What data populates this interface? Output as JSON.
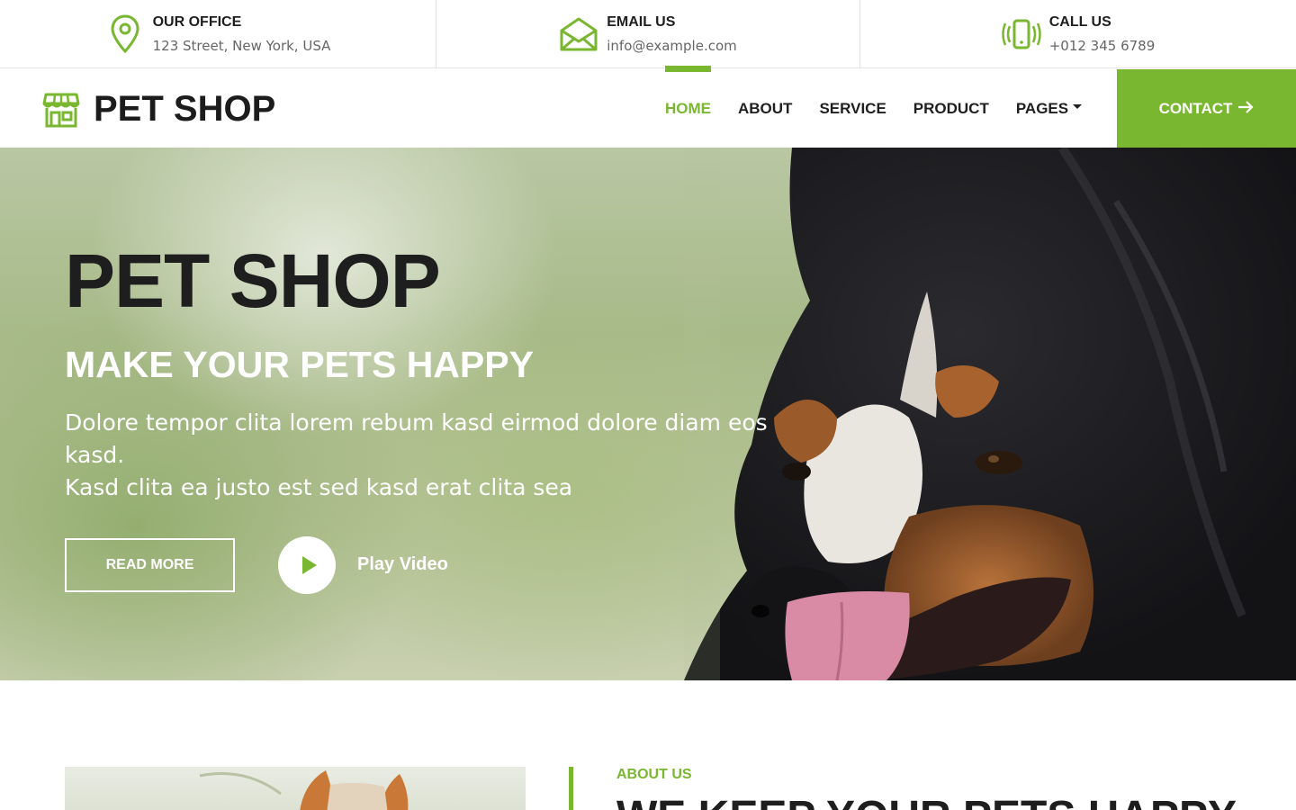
{
  "topbar": {
    "office": {
      "title": "OUR OFFICE",
      "text": "123 Street, New York, USA",
      "icon": "map-pin-icon"
    },
    "email": {
      "title": "EMAIL US",
      "text": "info@example.com",
      "icon": "envelope-icon"
    },
    "call": {
      "title": "CALL US",
      "text": "+012 345 6789",
      "icon": "vibrating-phone-icon"
    }
  },
  "brand": {
    "name": "PET SHOP",
    "icon": "storefront-icon"
  },
  "nav": {
    "items": [
      {
        "label": "HOME",
        "active": true
      },
      {
        "label": "ABOUT"
      },
      {
        "label": "SERVICE"
      },
      {
        "label": "PRODUCT"
      },
      {
        "label": "PAGES",
        "dropdown": true
      }
    ],
    "contact_label": "CONTACT",
    "contact_icon": "arrow-right-icon"
  },
  "hero": {
    "title": "PET SHOP",
    "subtitle": "MAKE YOUR PETS HAPPY",
    "text_line1": "Dolore tempor clita lorem rebum kasd eirmod dolore diam eos kasd.",
    "text_line2": "Kasd clita ea justo est sed kasd erat clita sea",
    "read_more": "READ MORE",
    "play_label": "Play Video"
  },
  "about": {
    "label": "ABOUT US",
    "heading": "WE KEEP YOUR PETS HAPPY"
  },
  "colors": {
    "accent": "#7ab730",
    "dark": "#1e1e1e"
  }
}
